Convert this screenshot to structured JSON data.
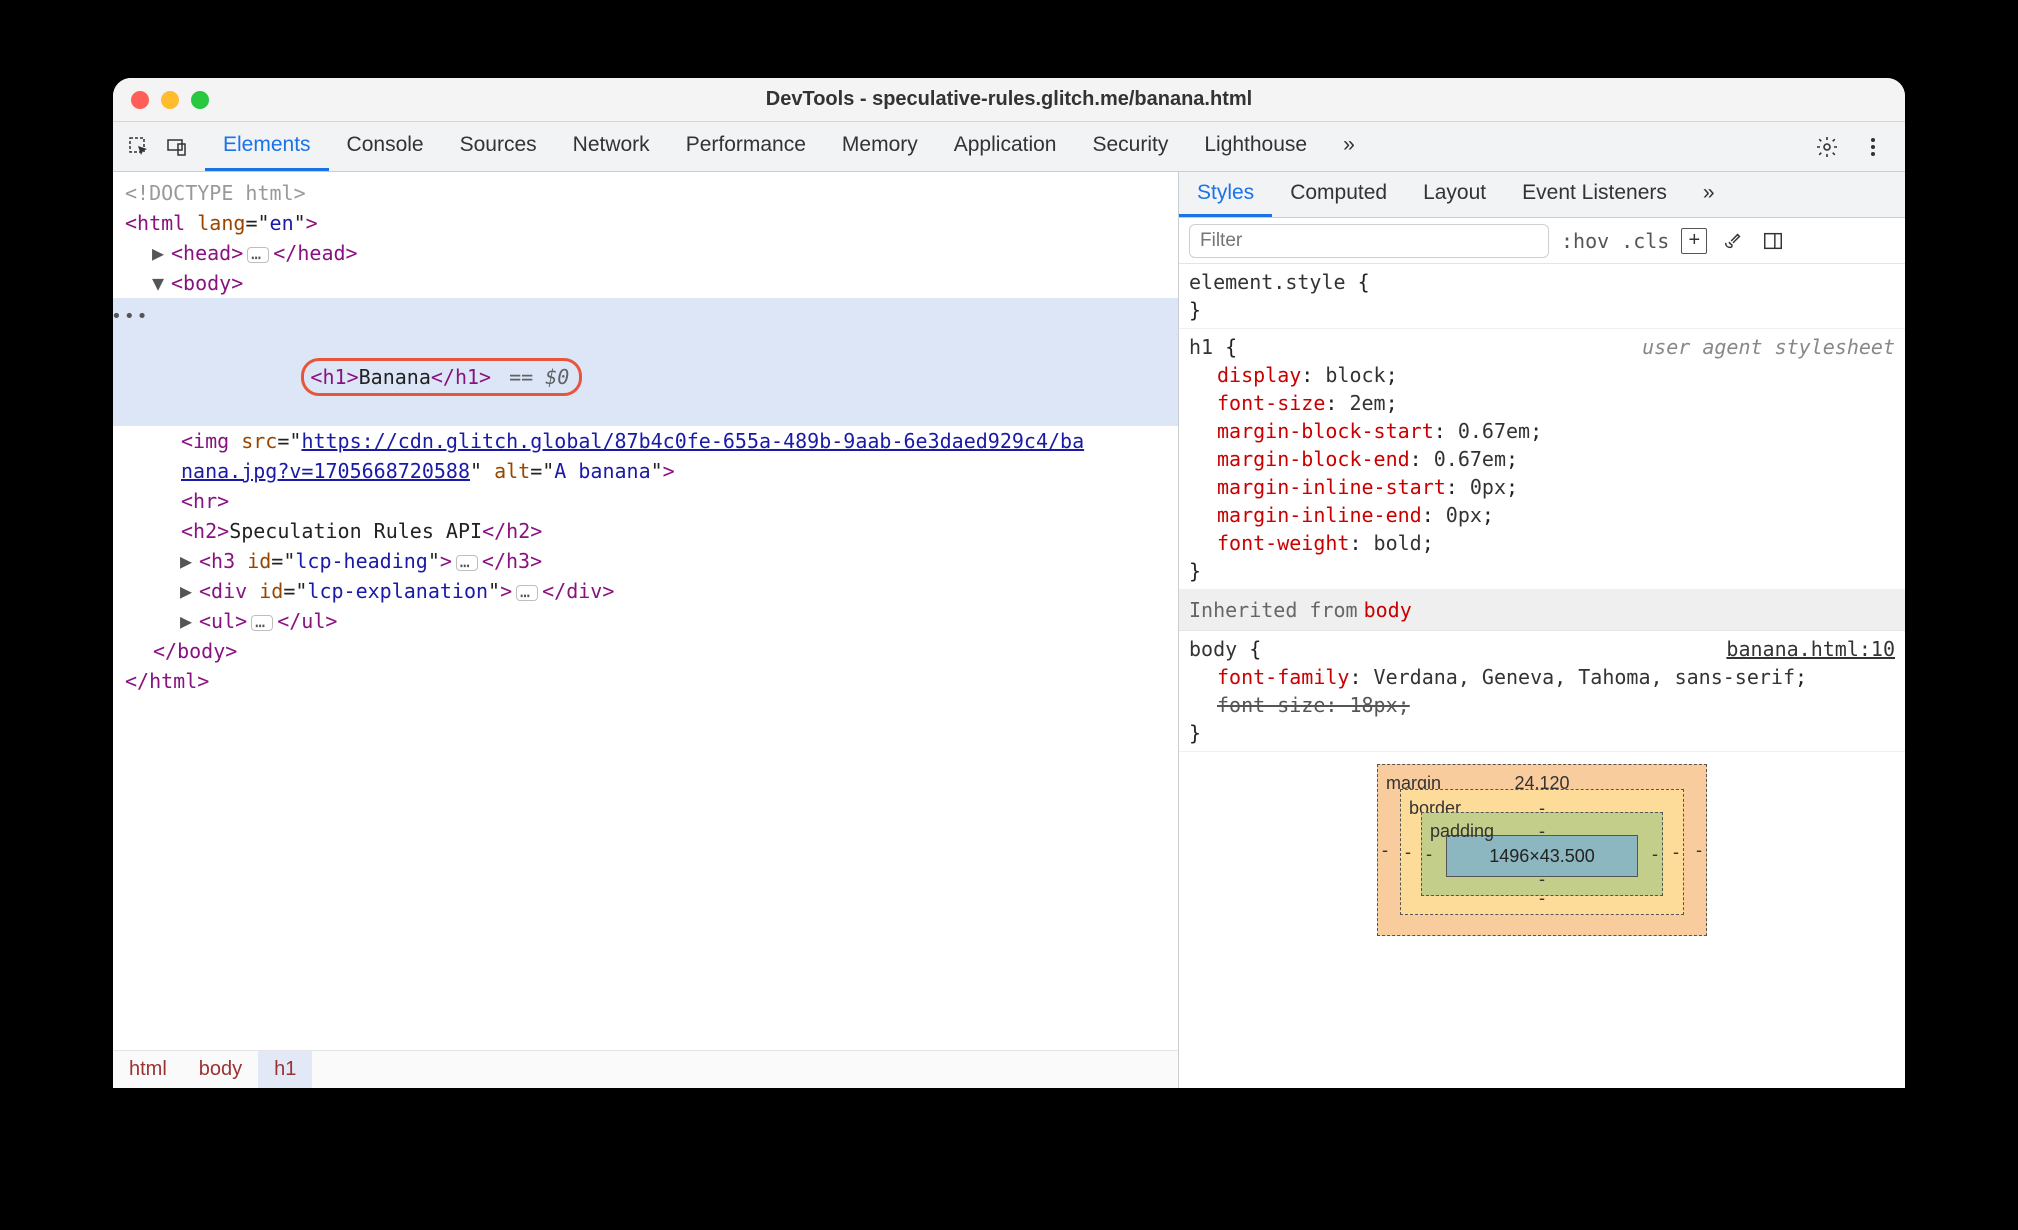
{
  "window": {
    "title": "DevTools - speculative-rules.glitch.me/banana.html"
  },
  "tabs": {
    "items": [
      "Elements",
      "Console",
      "Sources",
      "Network",
      "Performance",
      "Memory",
      "Application",
      "Security",
      "Lighthouse"
    ],
    "active": "Elements",
    "more": "»"
  },
  "dom": {
    "doctype": "<!DOCTYPE html>",
    "html_open_tag": "html",
    "html_lang_attr": "lang",
    "html_lang_val": "en",
    "head_tag": "head",
    "body_tag": "body",
    "h1_open": "h1",
    "h1_text": "Banana",
    "h1_close": "h1",
    "selected_ref": "== $0",
    "img_tag": "img",
    "img_src_attr": "src",
    "img_src_part1": "https://cdn.glitch.global/87b4c0fe-655a-489b-9aab-6e3daed929c4/ba",
    "img_src_part2": "nana.jpg?v=1705668720588",
    "img_alt_attr": "alt",
    "img_alt_val": "A banana",
    "hr_tag": "hr",
    "h2_open": "h2",
    "h2_text": "Speculation Rules API",
    "h2_close": "h2",
    "h3_tag": "h3",
    "h3_id_attr": "id",
    "h3_id_val": "lcp-heading",
    "div_tag": "div",
    "div_id_attr": "id",
    "div_id_val": "lcp-explanation",
    "ul_tag": "ul",
    "body_close": "body",
    "html_close": "html",
    "gutter_dots": "•••"
  },
  "crumbs": [
    "html",
    "body",
    "h1"
  ],
  "styles_tabs": {
    "items": [
      "Styles",
      "Computed",
      "Layout",
      "Event Listeners"
    ],
    "active": "Styles",
    "more": "»"
  },
  "styles_toolbar": {
    "filter_placeholder": "Filter",
    "hov": ":hov",
    "cls": ".cls"
  },
  "rules": {
    "element_style_sel": "element.style",
    "h1_sel": "h1",
    "ua_label": "user agent stylesheet",
    "h1_decls": [
      {
        "prop": "display",
        "val": "block"
      },
      {
        "prop": "font-size",
        "val": "2em"
      },
      {
        "prop": "margin-block-start",
        "val": "0.67em"
      },
      {
        "prop": "margin-block-end",
        "val": "0.67em"
      },
      {
        "prop": "margin-inline-start",
        "val": "0px"
      },
      {
        "prop": "margin-inline-end",
        "val": "0px"
      },
      {
        "prop": "font-weight",
        "val": "bold"
      }
    ],
    "inherit_label": "Inherited from",
    "inherit_from": "body",
    "body_sel": "body",
    "body_source": "banana.html:10",
    "body_decls": [
      {
        "prop": "font-family",
        "val": "Verdana, Geneva, Tahoma, sans-serif",
        "strike": false
      },
      {
        "prop": "font-size",
        "val": "18px",
        "strike": true
      }
    ]
  },
  "boxmodel": {
    "margin_label": "margin",
    "border_label": "border",
    "padding_label": "padding",
    "margin_top": "24.120",
    "dash": "-",
    "content": "1496×43.500"
  }
}
